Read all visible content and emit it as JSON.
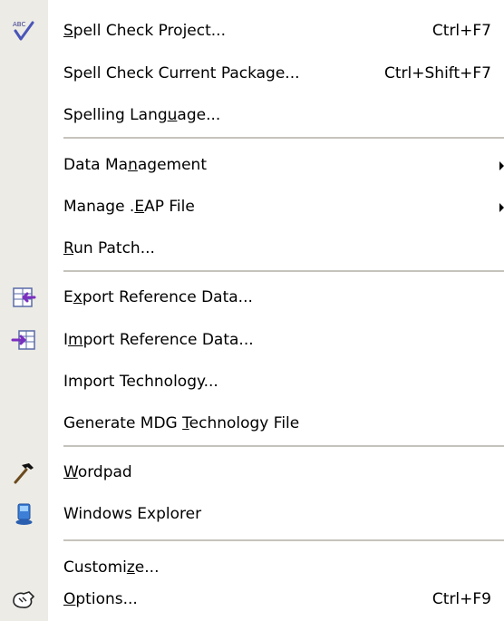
{
  "menu": {
    "items": [
      {
        "pre": "",
        "ul": "S",
        "post": "pell Check Project...",
        "shortcut": "Ctrl+F7",
        "icon": "spell-check-icon"
      },
      {
        "label": "Spell Check Current Package...",
        "shortcut": "Ctrl+Shift+F7"
      },
      {
        "pre": "Spelling Lang",
        "ul": "u",
        "post": "age..."
      },
      {
        "pre": "Data Ma",
        "ul": "n",
        "post": "agement",
        "submenu": true
      },
      {
        "pre": "Manage .",
        "ul": "E",
        "post": "AP File",
        "submenu": true
      },
      {
        "pre": "",
        "ul": "R",
        "post": "un Patch..."
      },
      {
        "pre": "E",
        "ul": "x",
        "post": "port Reference Data...",
        "icon": "export-data-icon"
      },
      {
        "pre": "I",
        "ul": "m",
        "post": "port Reference Data...",
        "icon": "import-data-icon"
      },
      {
        "label": "Import Technology..."
      },
      {
        "pre": "Generate MDG ",
        "ul": "T",
        "post": "echnology File"
      },
      {
        "pre": "",
        "ul": "W",
        "post": "ordpad",
        "icon": "hammer-icon"
      },
      {
        "label": "Windows Explorer",
        "icon": "windows-explorer-icon"
      },
      {
        "pre": "Customi",
        "ul": "z",
        "post": "e..."
      },
      {
        "pre": "",
        "ul": "O",
        "post": "ptions...",
        "shortcut": "Ctrl+F9",
        "icon": "options-icon"
      }
    ]
  },
  "colors": {
    "gutter": "#ecebe5",
    "separator": "#c5c3bc",
    "text": "#000000"
  }
}
